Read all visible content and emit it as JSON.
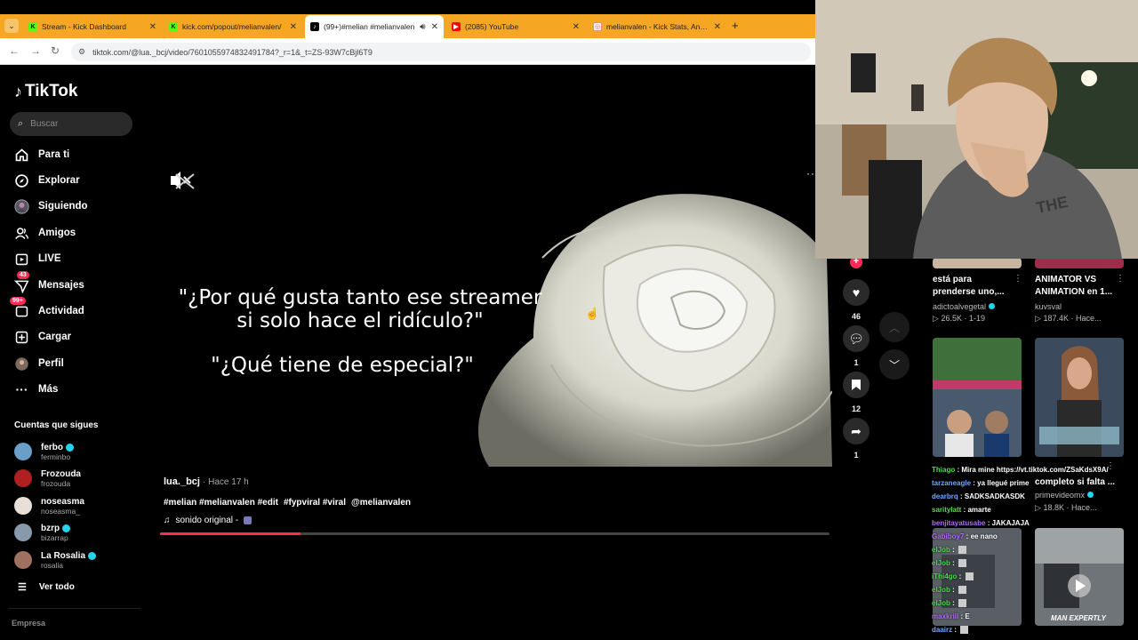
{
  "browser": {
    "tabs": [
      {
        "title": "Stream - Kick Dashboard",
        "favicon": "K",
        "color": "#53fc18"
      },
      {
        "title": "kick.com/popout/melianvalen/",
        "favicon": "K",
        "color": "#53fc18"
      },
      {
        "title": "(99+)#melian #melianvalen",
        "favicon": "♪",
        "color": "#000000"
      },
      {
        "title": "(2085) YouTube",
        "favicon": "▶",
        "color": "#ff0000"
      },
      {
        "title": "melianvalen - Kick Stats, Analyt",
        "favicon": "◎",
        "color": "#e88"
      }
    ],
    "new_tab": "+",
    "url": "tiktok.com/@lua._bcj/video/7601055974832491784?_r=1&_t=ZS-93W7cBjl6T9"
  },
  "tiktok": {
    "logo": "TikTok",
    "search_placeholder": "Buscar",
    "nav": [
      {
        "label": "Para ti",
        "icon": "home-icon"
      },
      {
        "label": "Explorar",
        "icon": "compass-icon"
      },
      {
        "label": "Siguiendo",
        "icon": "following-avatar-icon"
      },
      {
        "label": "Amigos",
        "icon": "friends-icon"
      },
      {
        "label": "LIVE",
        "icon": "live-icon"
      },
      {
        "label": "Mensajes",
        "icon": "messages-icon",
        "badge": "43"
      },
      {
        "label": "Actividad",
        "icon": "activity-icon",
        "badge": "99+"
      },
      {
        "label": "Cargar",
        "icon": "upload-icon"
      },
      {
        "label": "Perfil",
        "icon": "profile-icon"
      },
      {
        "label": "Más",
        "icon": "more-icon"
      }
    ],
    "following_title": "Cuentas que sigues",
    "following": [
      {
        "name": "ferbo",
        "handle": "ferminbo",
        "verified": true,
        "color": "#6aa0c8"
      },
      {
        "name": "Frozouda",
        "handle": "frozouda",
        "verified": false,
        "color": "#b02020"
      },
      {
        "name": "noseasma",
        "handle": "noseasma_",
        "verified": false,
        "color": "#e8e0d8"
      },
      {
        "name": "bzrp",
        "handle": "bizarrap",
        "verified": true,
        "color": "#8899aa"
      },
      {
        "name": "La Rosalia",
        "handle": "rosalia",
        "verified": true,
        "color": "#a07060"
      }
    ],
    "see_all": "Ver todo",
    "company": "Empresa"
  },
  "video": {
    "quote_line1": "\"¿Por qué gusta tanto ese streamer",
    "quote_line2": "si solo hace el ridículo?\"",
    "quote_line3": "\"¿Qué tiene de especial?\"",
    "author": "lua._bcj",
    "time": "· Hace 17 h",
    "tags": [
      "#melian #melianvalen #edit",
      "#fypviral #viral",
      "@melianvalen"
    ],
    "sound": "sonido original -",
    "progress": 0.21,
    "likes": "46",
    "comments": "1",
    "saves": "12",
    "shares": "1"
  },
  "suggested": [
    {
      "title_l1": "está para",
      "title_l2": "prenderse uno,...",
      "author": "adictoalvegetal",
      "verified": true,
      "meta": "26.5K · 1-19"
    },
    {
      "title_l1": "ANIMATOR VS",
      "title_l2": "ANIMATION en 1...",
      "author": "kuvsval",
      "verified": false,
      "meta": "187.4K · Hace..."
    },
    {
      "title_l1": "",
      "title_l2": "completo si falta ...",
      "author": "primevideomx",
      "verified": true,
      "meta": "18.8K · Hace..."
    },
    {
      "overlay": "MAN EXPERTLY"
    }
  ],
  "chat": [
    {
      "user": "Thiago",
      "cls": "g",
      "text": "Mira mine https://vt.tiktok.com/ZSaKdsX9A/"
    },
    {
      "user": "tarzaneagle",
      "cls": "u",
      "text": "ya llegué prime"
    },
    {
      "user": "dearbrq",
      "cls": "u",
      "text": "SADKSADKASDK"
    },
    {
      "user": "saritylatt",
      "cls": "g",
      "text": "amarte"
    },
    {
      "user": "benjitayatusabe",
      "cls": "p",
      "text": "JAKAJAJA"
    },
    {
      "user": "Gabiboy7",
      "cls": "p",
      "text": "ee nano"
    },
    {
      "user": "elJob",
      "cls": "g",
      "text": ""
    },
    {
      "user": "elJob",
      "cls": "g",
      "text": ""
    },
    {
      "user": "iThi4go",
      "cls": "g",
      "text": ""
    },
    {
      "user": "elJob",
      "cls": "g",
      "text": ""
    },
    {
      "user": "elJob",
      "cls": "g",
      "text": ""
    },
    {
      "user": "maxkrill",
      "cls": "p",
      "text": "E"
    },
    {
      "user": "daairz",
      "cls": "u",
      "text": ""
    }
  ]
}
